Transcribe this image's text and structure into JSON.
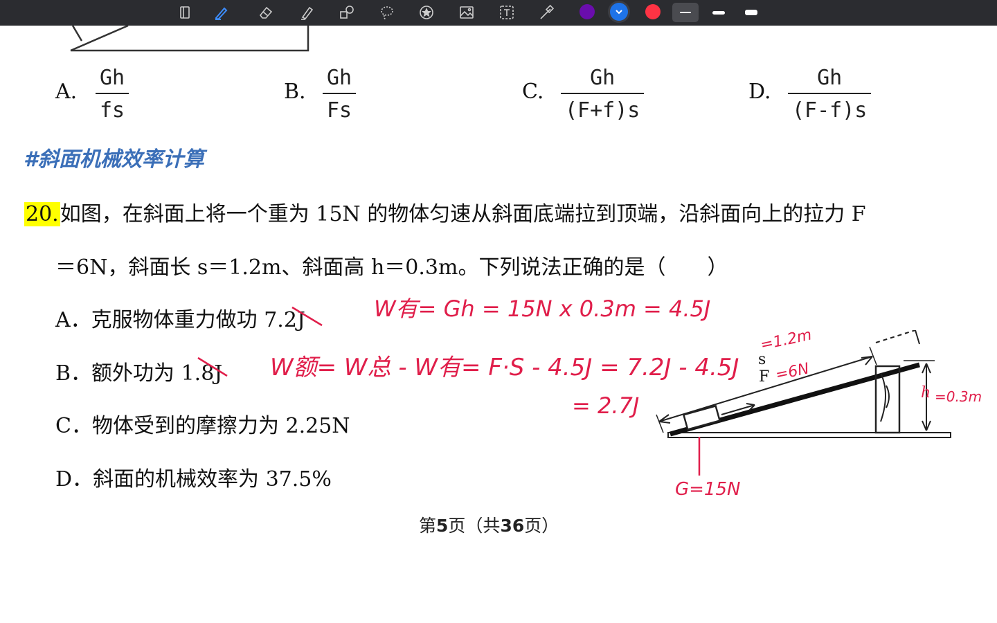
{
  "colors": {
    "toolbar_bg": "#2b2c30",
    "topic_blue": "#3b6fb8",
    "highlight": "#ffff00",
    "annotation_red": "#e01e4a",
    "dot_purple": "#6a0dad",
    "dot_blue": "#1e73e8",
    "dot_red": "#ff3344"
  },
  "toolbar": {
    "icons": [
      "page-icon",
      "pen-icon",
      "eraser-icon",
      "highlighter-icon",
      "shapes-icon",
      "lasso-icon",
      "star-sticker-icon",
      "image-icon",
      "text-icon",
      "laser-pointer-icon"
    ],
    "colors": [
      "purple",
      "blue",
      "red"
    ],
    "stroke_widths": [
      "thin",
      "medium",
      "thick"
    ]
  },
  "prev_options": {
    "a": {
      "letter": "A.",
      "num": "Gh",
      "den": "fs"
    },
    "b": {
      "letter": "B.",
      "num": "Gh",
      "den": "Fs"
    },
    "c": {
      "letter": "C.",
      "num": "Gh",
      "den": "(F+f)s"
    },
    "d": {
      "letter": "D.",
      "num": "Gh",
      "den": "(F-f)s"
    }
  },
  "topic": "#斜面机械效率计算",
  "question": {
    "number": "20.",
    "line1": "如图，在斜面上将一个重为 15N 的物体匀速从斜面底端拉到顶端，沿斜面向上的拉力 F",
    "line2": "＝6N，斜面长 s＝1.2m、斜面高 h＝0.3m。下列说法正确的是（　　）",
    "options": [
      {
        "letter": "A．",
        "text": "克服物体重力做功 7.2J"
      },
      {
        "letter": "B．",
        "text": "额外功为 1.8J"
      },
      {
        "letter": "C．",
        "text": "物体受到的摩擦力为 2.25N"
      },
      {
        "letter": "D．",
        "text": "斜面的机械效率为 37.5%"
      }
    ]
  },
  "diagram": {
    "label_s": "s",
    "label_F": "F",
    "label_h": "h"
  },
  "annotations": {
    "w_useful": "W有= Gh = 15N x 0.3m = 4.5J",
    "w_extra": "W额= W总 - W有= F·S - 4.5J = 7.2J - 4.5J",
    "w_extra_result": "= 2.7J",
    "s_value": "=1.2m",
    "f_value": "=6N",
    "h_value": "=0.3m",
    "g_value": "G=15N"
  },
  "footer": {
    "pre": "第",
    "page": "5",
    "mid": "页（共",
    "total": "36",
    "post": "页）"
  }
}
